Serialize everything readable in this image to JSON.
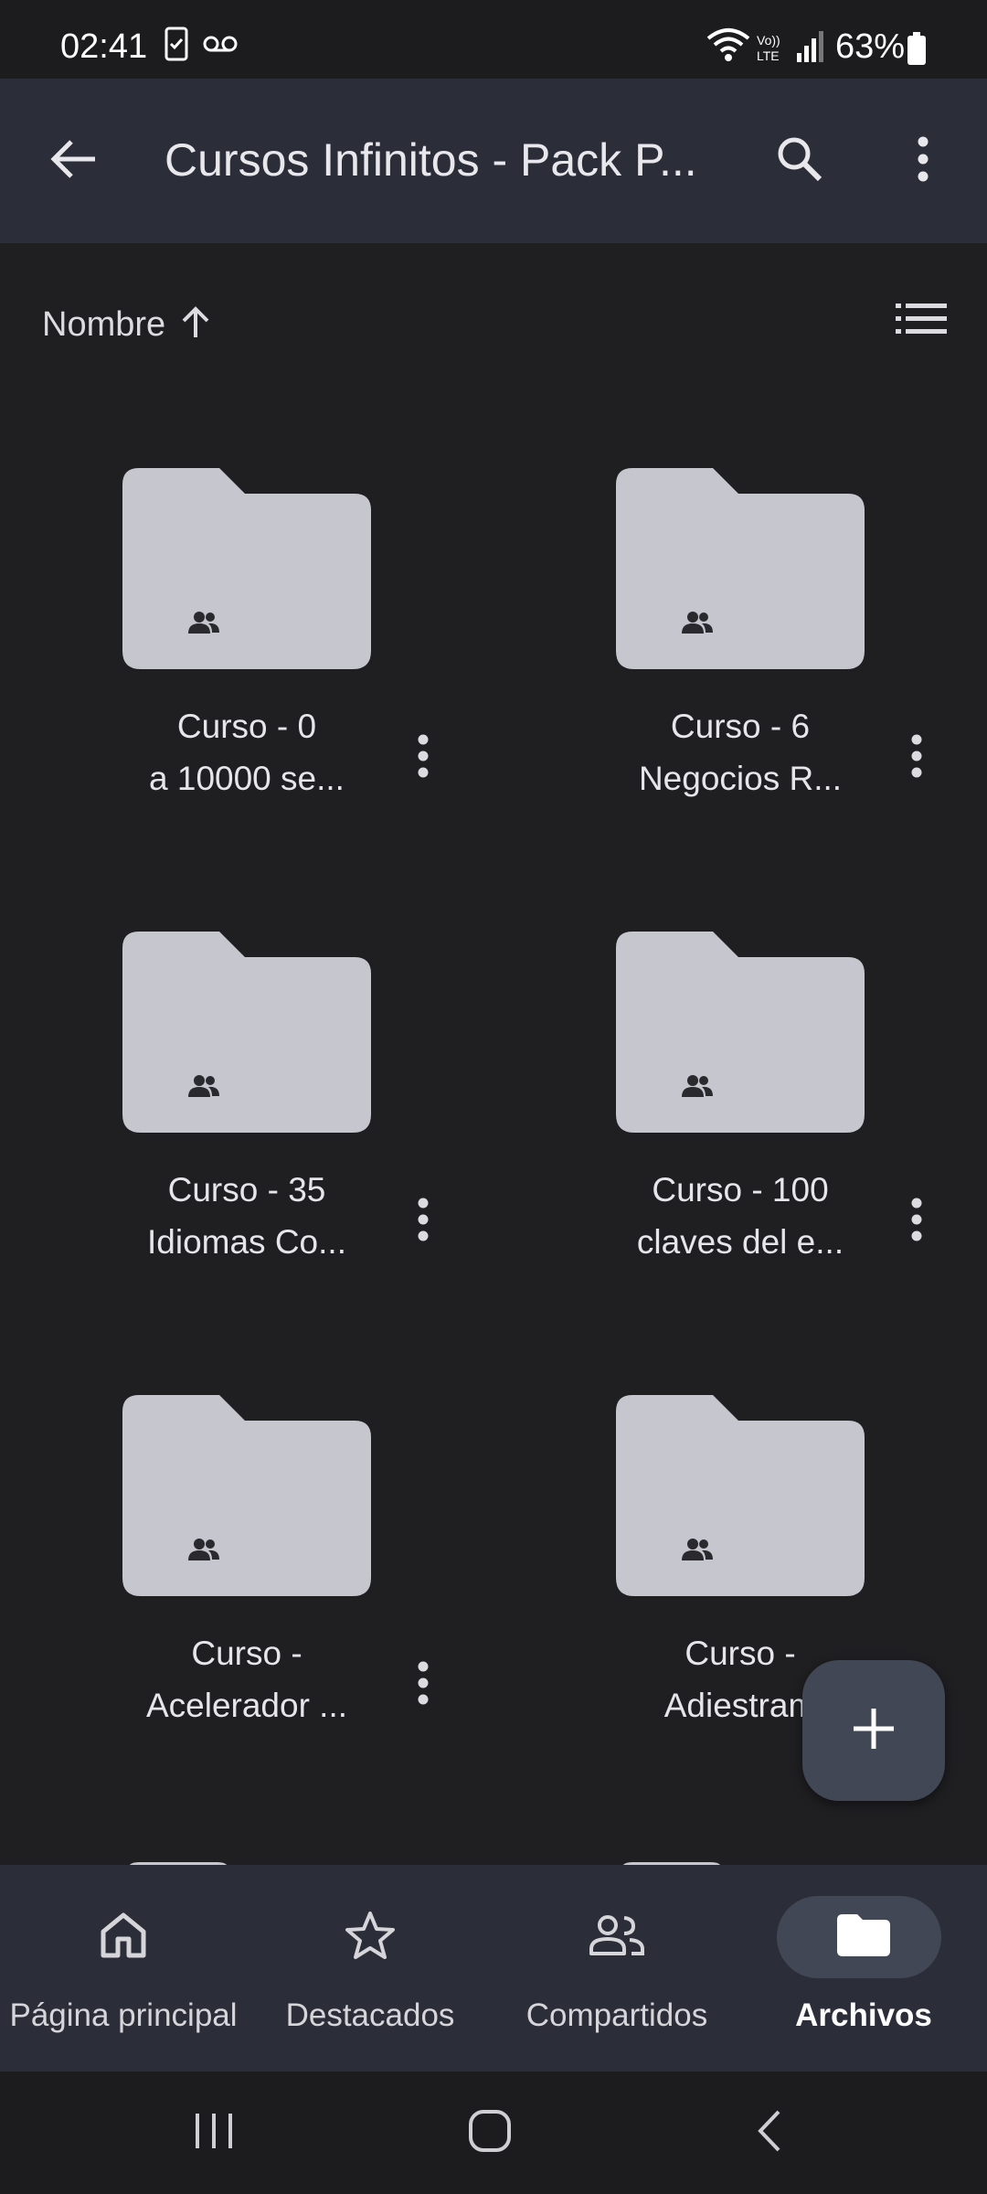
{
  "status_bar": {
    "time": "02:41",
    "battery": "63%",
    "icons": [
      "clipboard-notification-icon",
      "voicemail-icon",
      "wifi-icon",
      "volte-icon",
      "signal-icon",
      "battery-icon"
    ]
  },
  "app_bar": {
    "title": "Cursos Infinitos - Pack P...",
    "icons": [
      "back-arrow-icon",
      "search-icon",
      "more-vert-icon"
    ]
  },
  "sort": {
    "label": "Nombre",
    "direction_icon": "arrow-up-icon",
    "view_toggle_icon": "list-view-icon"
  },
  "folders": [
    {
      "line1": "Curso - 0",
      "line2": "a 10000 se...",
      "shared": true
    },
    {
      "line1": "Curso - 6",
      "line2": "Negocios R...",
      "shared": true
    },
    {
      "line1": "Curso - 35",
      "line2": "Idiomas Co...",
      "shared": true
    },
    {
      "line1": "Curso - 100",
      "line2": "claves del e...",
      "shared": true
    },
    {
      "line1": "Curso -",
      "line2": "Acelerador ...",
      "shared": true
    },
    {
      "line1": "Curso -",
      "line2": "Adiestram",
      "shared": true
    }
  ],
  "fab": {
    "icon": "plus-icon"
  },
  "bottom_nav": [
    {
      "label": "Página principal",
      "icon": "home-icon",
      "active": false
    },
    {
      "label": "Destacados",
      "icon": "star-icon",
      "active": false
    },
    {
      "label": "Compartidos",
      "icon": "people-icon",
      "active": false
    },
    {
      "label": "Archivos",
      "icon": "folder-icon",
      "active": true
    }
  ],
  "colors": {
    "background": "#1f1f22",
    "app_bar": "#2b2e38",
    "folder": "#c6c6ce",
    "accent_pill": "#414755"
  }
}
